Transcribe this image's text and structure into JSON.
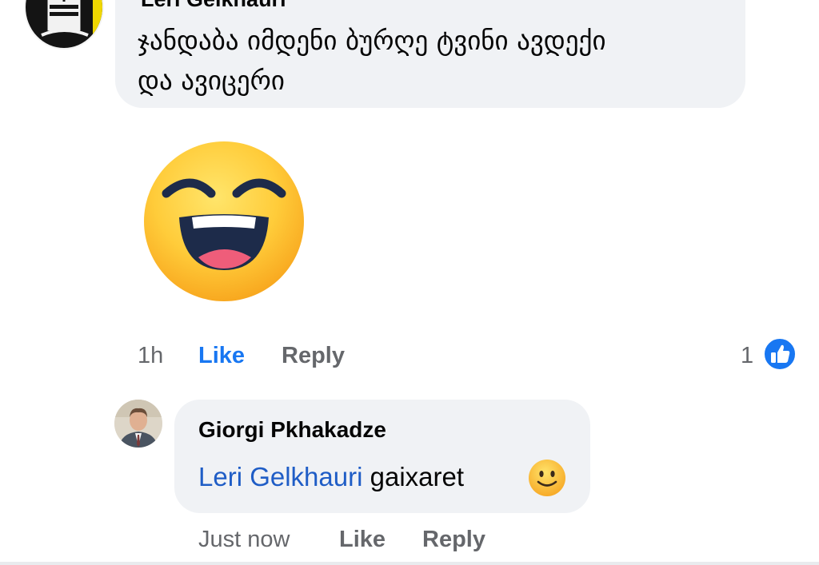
{
  "comment": {
    "author": "Leri Gelkhauri",
    "text_line1": "ჯანდაბა იმდენი ბურღე ტვინი ავდექი",
    "text_line2": "და ავიცერი",
    "sticker": "laughing-face-emoji",
    "time": "1h",
    "like_label": "Like",
    "reply_label": "Reply",
    "like_count": "1",
    "reaction_icon": "thumbs-up-icon",
    "like_active": true
  },
  "reply": {
    "author": "Giorgi Pkhakadze",
    "mention": "Leri Gelkhauri",
    "text": "gaixaret",
    "emoji": "slightly-smiling-face-emoji",
    "time": "Just now",
    "like_label": "Like",
    "reply_label": "Reply"
  },
  "colors": {
    "bubble": "#f0f2f5",
    "link_blue": "#1877f2",
    "mention_blue": "#1f5dc6",
    "meta_gray": "#65676b"
  }
}
